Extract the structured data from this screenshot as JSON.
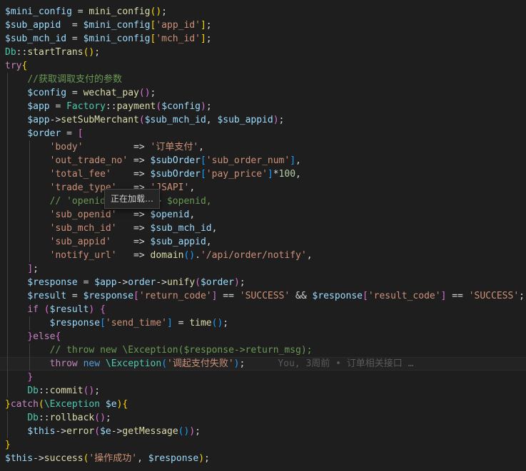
{
  "editor": {
    "tooltip": "正在加载…",
    "blame": "You, 3周前 • 订单相关接口 …",
    "lines": [
      [
        [
          "var",
          "$mini_config"
        ],
        [
          "op",
          " = "
        ],
        [
          "fn",
          "mini_config"
        ],
        [
          "b1",
          "()"
        ],
        [
          "op",
          ";"
        ]
      ],
      [
        [
          "var",
          "$sub_appid"
        ],
        [
          "op",
          "  = "
        ],
        [
          "var",
          "$mini_config"
        ],
        [
          "b1",
          "["
        ],
        [
          "str",
          "'app_id'"
        ],
        [
          "b1",
          "]"
        ],
        [
          "op",
          ";"
        ]
      ],
      [
        [
          "var",
          "$sub_mch_id"
        ],
        [
          "op",
          " = "
        ],
        [
          "var",
          "$mini_config"
        ],
        [
          "b1",
          "["
        ],
        [
          "str",
          "'mch_id'"
        ],
        [
          "b1",
          "]"
        ],
        [
          "op",
          ";"
        ]
      ],
      [
        [
          "cls",
          "Db"
        ],
        [
          "op",
          "::"
        ],
        [
          "fn",
          "startTrans"
        ],
        [
          "b1",
          "()"
        ],
        [
          "op",
          ";"
        ]
      ],
      [
        [
          "kw",
          "try"
        ],
        [
          "b1",
          "{"
        ]
      ],
      [
        [
          "op",
          "    "
        ],
        [
          "cmt",
          "//获取调取支付的参数"
        ]
      ],
      [
        [
          "op",
          "    "
        ],
        [
          "var",
          "$config"
        ],
        [
          "op",
          " = "
        ],
        [
          "fn",
          "wechat_pay"
        ],
        [
          "b2",
          "()"
        ],
        [
          "op",
          ";"
        ]
      ],
      [
        [
          "op",
          "    "
        ],
        [
          "var",
          "$app"
        ],
        [
          "op",
          " = "
        ],
        [
          "cls",
          "Factory"
        ],
        [
          "op",
          "::"
        ],
        [
          "fn",
          "payment"
        ],
        [
          "b2",
          "("
        ],
        [
          "var",
          "$config"
        ],
        [
          "b2",
          ")"
        ],
        [
          "op",
          ";"
        ]
      ],
      [
        [
          "op",
          "    "
        ],
        [
          "var",
          "$app"
        ],
        [
          "op",
          "->"
        ],
        [
          "fn",
          "setSubMerchant"
        ],
        [
          "b2",
          "("
        ],
        [
          "var",
          "$sub_mch_id"
        ],
        [
          "op",
          ", "
        ],
        [
          "var",
          "$sub_appid"
        ],
        [
          "b2",
          ")"
        ],
        [
          "op",
          ";"
        ]
      ],
      [
        [
          "op",
          "    "
        ],
        [
          "var",
          "$order"
        ],
        [
          "op",
          " = "
        ],
        [
          "b2",
          "["
        ]
      ],
      [
        [
          "op",
          "        "
        ],
        [
          "str",
          "'body'"
        ],
        [
          "op",
          "         => "
        ],
        [
          "str",
          "'订单支付'"
        ],
        [
          "op",
          ","
        ]
      ],
      [
        [
          "op",
          "        "
        ],
        [
          "str",
          "'out_trade_no'"
        ],
        [
          "op",
          " => "
        ],
        [
          "var",
          "$subOrder"
        ],
        [
          "b3",
          "["
        ],
        [
          "str",
          "'sub_order_num'"
        ],
        [
          "b3",
          "]"
        ],
        [
          "op",
          ","
        ]
      ],
      [
        [
          "op",
          "        "
        ],
        [
          "str",
          "'total_fee'"
        ],
        [
          "op",
          "    => "
        ],
        [
          "var",
          "$subOrder"
        ],
        [
          "b3",
          "["
        ],
        [
          "str",
          "'pay_price'"
        ],
        [
          "b3",
          "]"
        ],
        [
          "op",
          "*"
        ],
        [
          "num",
          "100"
        ],
        [
          "op",
          ","
        ]
      ],
      [
        [
          "op",
          "        "
        ],
        [
          "str",
          "'trade_type'"
        ],
        [
          "op",
          "   => "
        ],
        [
          "str",
          "'JSAPI'"
        ],
        [
          "op",
          ","
        ]
      ],
      [
        [
          "op",
          "        "
        ],
        [
          "cmt",
          "// 'openid'       => $openid,"
        ]
      ],
      [
        [
          "op",
          "        "
        ],
        [
          "str",
          "'sub_openid'"
        ],
        [
          "op",
          "   => "
        ],
        [
          "var",
          "$openid"
        ],
        [
          "op",
          ","
        ]
      ],
      [
        [
          "op",
          "        "
        ],
        [
          "str",
          "'sub_mch_id'"
        ],
        [
          "op",
          "   => "
        ],
        [
          "var",
          "$sub_mch_id"
        ],
        [
          "op",
          ","
        ]
      ],
      [
        [
          "op",
          "        "
        ],
        [
          "str",
          "'sub_appid'"
        ],
        [
          "op",
          "    => "
        ],
        [
          "var",
          "$sub_appid"
        ],
        [
          "op",
          ","
        ]
      ],
      [
        [
          "op",
          "        "
        ],
        [
          "str",
          "'notify_url'"
        ],
        [
          "op",
          "   => "
        ],
        [
          "fn",
          "domain"
        ],
        [
          "b3",
          "()"
        ],
        [
          "op",
          "."
        ],
        [
          "str",
          "'/api/order/notify'"
        ],
        [
          "op",
          ","
        ]
      ],
      [
        [
          "op",
          "    "
        ],
        [
          "b2",
          "]"
        ],
        [
          "op",
          ";"
        ]
      ],
      [
        [
          "op",
          "    "
        ],
        [
          "var",
          "$response"
        ],
        [
          "op",
          " = "
        ],
        [
          "var",
          "$app"
        ],
        [
          "op",
          "->"
        ],
        [
          "var",
          "order"
        ],
        [
          "op",
          "->"
        ],
        [
          "fn",
          "unify"
        ],
        [
          "b2",
          "("
        ],
        [
          "var",
          "$order"
        ],
        [
          "b2",
          ")"
        ],
        [
          "op",
          ";"
        ]
      ],
      [
        [
          "op",
          "    "
        ],
        [
          "var",
          "$result"
        ],
        [
          "op",
          " = "
        ],
        [
          "var",
          "$response"
        ],
        [
          "b2",
          "["
        ],
        [
          "str",
          "'return_code'"
        ],
        [
          "b2",
          "]"
        ],
        [
          "op",
          " == "
        ],
        [
          "str",
          "'SUCCESS'"
        ],
        [
          "op",
          " && "
        ],
        [
          "var",
          "$response"
        ],
        [
          "b2",
          "["
        ],
        [
          "str",
          "'result_code'"
        ],
        [
          "b2",
          "]"
        ],
        [
          "op",
          " == "
        ],
        [
          "str",
          "'SUCCESS'"
        ],
        [
          "op",
          ";"
        ]
      ],
      [
        [
          "op",
          "    "
        ],
        [
          "kw",
          "if"
        ],
        [
          "op",
          " "
        ],
        [
          "b2",
          "("
        ],
        [
          "var",
          "$result"
        ],
        [
          "b2",
          ")"
        ],
        [
          "op",
          " "
        ],
        [
          "b2",
          "{"
        ]
      ],
      [
        [
          "op",
          "        "
        ],
        [
          "var",
          "$response"
        ],
        [
          "b3",
          "["
        ],
        [
          "str",
          "'send_time'"
        ],
        [
          "b3",
          "]"
        ],
        [
          "op",
          " = "
        ],
        [
          "fn",
          "time"
        ],
        [
          "b3",
          "()"
        ],
        [
          "op",
          ";"
        ]
      ],
      [
        [
          "op",
          "    "
        ],
        [
          "b2",
          "}"
        ],
        [
          "kw",
          "else"
        ],
        [
          "b2",
          "{"
        ]
      ],
      [
        [
          "op",
          "        "
        ],
        [
          "cmt",
          "// throw new \\Exception($response->return_msg);"
        ]
      ],
      [
        [
          "op",
          "        "
        ],
        [
          "kw",
          "throw"
        ],
        [
          "op",
          " "
        ],
        [
          "kwb",
          "new"
        ],
        [
          "op",
          " "
        ],
        [
          "cls",
          "\\Exception"
        ],
        [
          "b3",
          "("
        ],
        [
          "str",
          "'调起支付失败'"
        ],
        [
          "b3",
          ")"
        ],
        [
          "op",
          ";"
        ]
      ],
      [
        [
          "op",
          "    "
        ],
        [
          "b2",
          "}"
        ]
      ],
      [
        [
          "op",
          "    "
        ],
        [
          "cls",
          "Db"
        ],
        [
          "op",
          "::"
        ],
        [
          "fn",
          "commit"
        ],
        [
          "b2",
          "()"
        ],
        [
          "op",
          ";"
        ]
      ],
      [
        [
          "b1",
          "}"
        ],
        [
          "kw",
          "catch"
        ],
        [
          "b1",
          "("
        ],
        [
          "cls",
          "\\Exception"
        ],
        [
          "op",
          " "
        ],
        [
          "var",
          "$e"
        ],
        [
          "b1",
          ")"
        ],
        [
          "b1",
          "{"
        ]
      ],
      [
        [
          "op",
          "    "
        ],
        [
          "cls",
          "Db"
        ],
        [
          "op",
          "::"
        ],
        [
          "fn",
          "rollback"
        ],
        [
          "b2",
          "()"
        ],
        [
          "op",
          ";"
        ]
      ],
      [
        [
          "op",
          "    "
        ],
        [
          "var",
          "$this"
        ],
        [
          "op",
          "->"
        ],
        [
          "fn",
          "error"
        ],
        [
          "b2",
          "("
        ],
        [
          "var",
          "$e"
        ],
        [
          "op",
          "->"
        ],
        [
          "fn",
          "getMessage"
        ],
        [
          "b3",
          "()"
        ],
        [
          "b2",
          ")"
        ],
        [
          "op",
          ";"
        ]
      ],
      [
        [
          "b1",
          "}"
        ]
      ],
      [
        [
          "var",
          "$this"
        ],
        [
          "op",
          "->"
        ],
        [
          "fn",
          "success"
        ],
        [
          "b1",
          "("
        ],
        [
          "str",
          "'操作成功'"
        ],
        [
          "op",
          ", "
        ],
        [
          "var",
          "$response"
        ],
        [
          "b1",
          ")"
        ],
        [
          "op",
          ";"
        ]
      ]
    ]
  }
}
